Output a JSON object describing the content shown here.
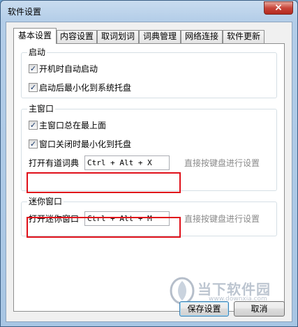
{
  "window": {
    "title": "软件设置",
    "close_glyph": "×"
  },
  "tabs": [
    {
      "label": "基本设置",
      "active": true
    },
    {
      "label": "内容设置",
      "active": false
    },
    {
      "label": "取词划词",
      "active": false
    },
    {
      "label": "词典管理",
      "active": false
    },
    {
      "label": "网络连接",
      "active": false
    },
    {
      "label": "软件更新",
      "active": false
    }
  ],
  "startup": {
    "title": "启动",
    "auto_start": {
      "label": "开机时自动启动",
      "checked": true
    },
    "minimize_tray": {
      "label": "启动后最小化到系统托盘",
      "checked": true
    }
  },
  "main_window": {
    "title": "主窗口",
    "always_on_top": {
      "label": "主窗口总在最上面",
      "checked": true
    },
    "close_to_tray": {
      "label": "窗口关闭时最小化到托盘",
      "checked": true
    },
    "hotkey": {
      "label": "打开有道词典",
      "value": "Ctrl + Alt + X",
      "hint": "直接按键盘进行设置"
    }
  },
  "mini_window": {
    "title": "迷你窗口",
    "hotkey": {
      "label": "打开迷你窗口",
      "value": "Ctrl + Alt + M",
      "hint": "直接按键盘进行设置"
    }
  },
  "watermark": {
    "brand": "当下软件园",
    "url": "www.downxia.com"
  },
  "footer": {
    "save_label": "保存设置",
    "cancel_label": "取消"
  },
  "accent": {
    "highlight_red": "#e0101a",
    "check_color": "#1a3a6b"
  }
}
